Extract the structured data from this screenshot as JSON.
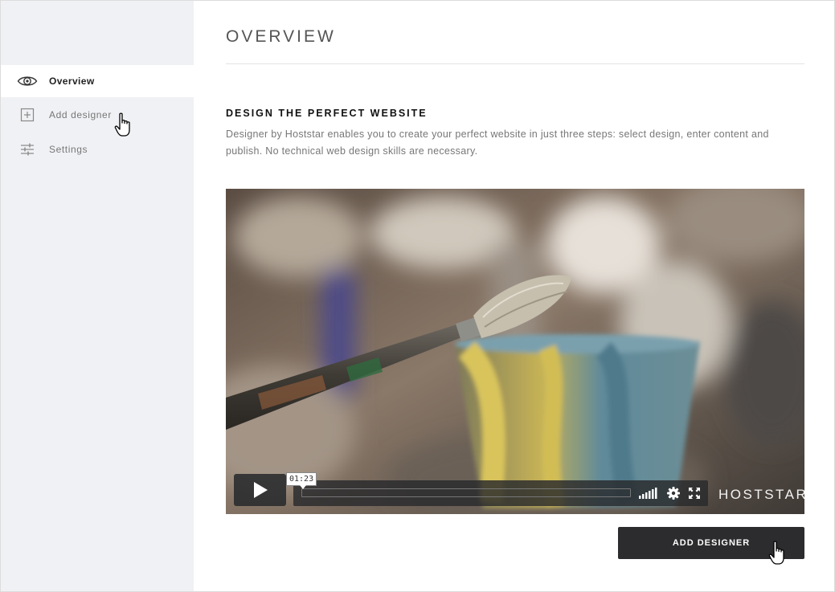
{
  "sidebar": {
    "items": [
      {
        "label": "Overview",
        "icon": "eye-icon",
        "active": true
      },
      {
        "label": "Add designer",
        "icon": "plus-square-icon",
        "active": false
      },
      {
        "label": "Settings",
        "icon": "sliders-icon",
        "active": false
      }
    ]
  },
  "main": {
    "title": "OVERVIEW",
    "section": {
      "heading": "DESIGN THE PERFECT WEBSITE",
      "description": "Designer by Hoststar enables you to create your perfect website in just three steps: select design, enter content and publish. No technical web design skills are necessary."
    },
    "video": {
      "time_tooltip": "01:23",
      "brand": "HOSTSTAR",
      "controls": [
        "play-icon",
        "volume-icon",
        "gear-icon",
        "fullscreen-icon"
      ]
    },
    "primary_button": "ADD DESIGNER"
  },
  "colors": {
    "sidebar_bg": "#f0f1f4",
    "button_bg": "#2c2c2e",
    "control_bg": "#282a2c"
  }
}
